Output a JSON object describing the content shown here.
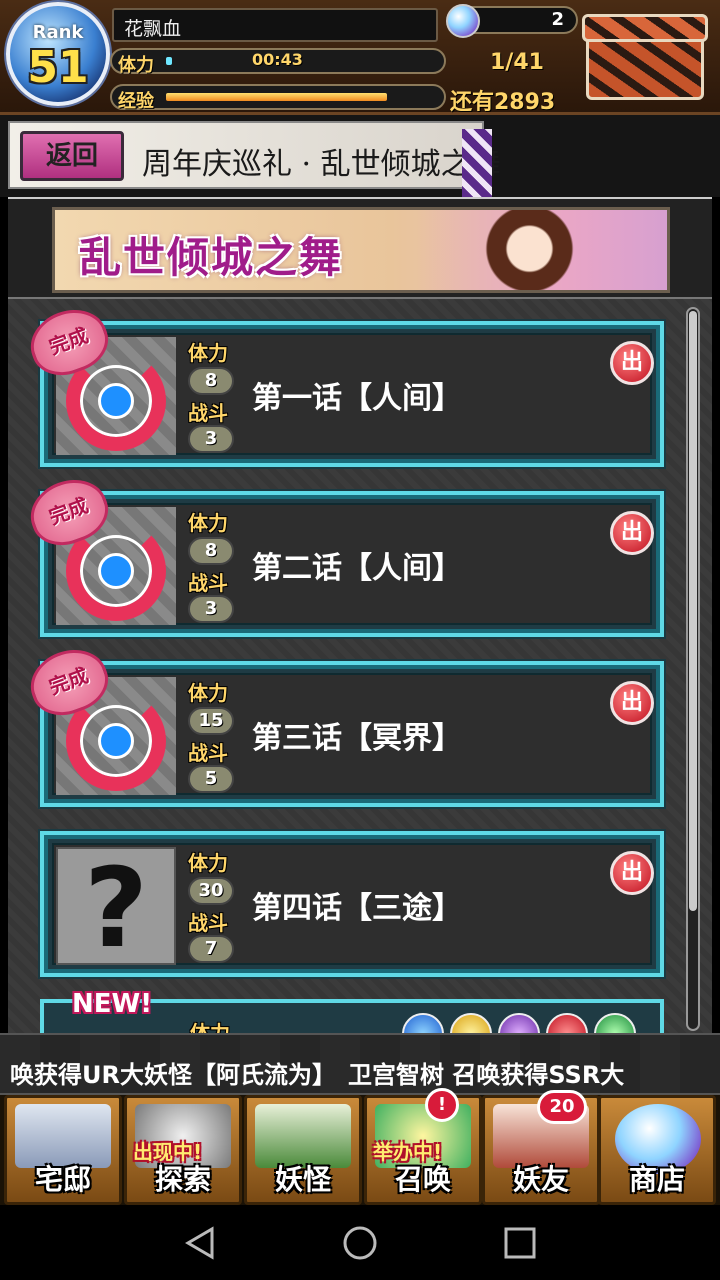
{
  "header": {
    "rank_label": "Rank",
    "rank_value": "51",
    "player_name": "花飘血",
    "stamina_label": "体力",
    "stamina_timer": "00:43",
    "stamina_fill": 0.02,
    "exp_label": "经验",
    "exp_fill": 0.82,
    "gem_count": "2",
    "stamina_progress": "1/41",
    "exp_remaining": "还有2893"
  },
  "title_strip": {
    "back_label": "返回",
    "title": "周年庆巡礼 · 乱世倾城之舞"
  },
  "event_banner": {
    "text": "乱世倾城之舞"
  },
  "stages": [
    {
      "name": "第一话【人间】",
      "stamina_label": "体力",
      "stamina": "8",
      "battle_label": "战斗",
      "battles": "3",
      "complete_label": "完成",
      "emblem": "出"
    },
    {
      "name": "第二话【人间】",
      "stamina_label": "体力",
      "stamina": "8",
      "battle_label": "战斗",
      "battles": "3",
      "complete_label": "完成",
      "emblem": "出"
    },
    {
      "name": "第三话【冥界】",
      "stamina_label": "体力",
      "stamina": "15",
      "battle_label": "战斗",
      "battles": "5",
      "complete_label": "完成",
      "emblem": "出"
    },
    {
      "name": "第四话【三途】",
      "stamina_label": "体力",
      "stamina": "30",
      "battle_label": "战斗",
      "battles": "7",
      "unknown_mark": "?",
      "emblem": "出"
    }
  ],
  "new_stage": {
    "badge": "NEW!",
    "cost_label": "体力"
  },
  "ticker": {
    "text": "唤获得UR大妖怪【阿氏流为】　卫宫智树 召唤获得SSR大"
  },
  "bottom_nav": {
    "home": "宅邸",
    "explore": "探索",
    "explore_tag": "出现中!",
    "yokai": "妖怪",
    "summon": "召唤",
    "summon_tag": "举办中!",
    "summon_badge": "!",
    "friends": "妖友",
    "friends_badge": "20",
    "shop": "商店"
  },
  "colors": {
    "card_border": "#5fd9e6",
    "stamina_fill": "#6fe7ff",
    "exp_fill": "#f08a20",
    "accent_pink": "#e8325a",
    "gold_text": "#ffd66a"
  }
}
